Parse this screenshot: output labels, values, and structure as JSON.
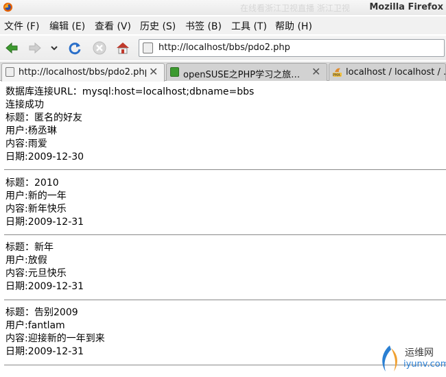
{
  "window": {
    "title": "Mozilla Firefox",
    "ghost_title": "在线看浙江卫视直播  浙江卫视"
  },
  "menu": [
    {
      "label": "文件 (F)"
    },
    {
      "label": "编辑 (E)"
    },
    {
      "label": "查看 (V)"
    },
    {
      "label": "历史 (S)"
    },
    {
      "label": "书签 (B)"
    },
    {
      "label": "工具 (T)"
    },
    {
      "label": "帮助 (H)"
    }
  ],
  "toolbar": {
    "back_icon": "back-arrow-icon",
    "forward_icon": "forward-arrow-icon",
    "history_icon": "chevron-down-icon",
    "reload_icon": "reload-icon",
    "stop_icon": "stop-icon",
    "home_icon": "home-icon"
  },
  "address_bar": {
    "url": "http://localhost/bbs/pdo2.php"
  },
  "tabs": [
    {
      "label": "http://localhost/bbs/pdo2.php",
      "active": true
    },
    {
      "label": "openSUSE之PHP学习之旅…",
      "active": false
    },
    {
      "label": "localhost / localhost / …",
      "active": false
    }
  ],
  "page": {
    "header_lines": [
      "数据库连接URL：mysql:host=localhost;dbname=bbs",
      "连接成功"
    ],
    "posts": [
      {
        "title": "标题：匿名的好友",
        "user": "用户:杨丞琳",
        "content": "内容:雨爱",
        "date": "日期:2009-12-30"
      },
      {
        "title": "标题：2010",
        "user": "用户:新的一年",
        "content": "内容:新年快乐",
        "date": "日期:2009-12-31"
      },
      {
        "title": "标题：新年",
        "user": "用户:放假",
        "content": "内容:元旦快乐",
        "date": "日期:2009-12-31"
      },
      {
        "title": "标题：告别2009",
        "user": "用户:fantlam",
        "content": "内容:迎接新的一年到来",
        "date": "日期:2009-12-31"
      }
    ]
  },
  "watermark": {
    "line1": "运维网",
    "line2": "iyunv.com"
  },
  "colors": {
    "accent_green": "#3c9a2f",
    "reload_blue": "#2a6fc9",
    "home_red": "#c0392b",
    "watermark_blue": "#2a7fd3"
  }
}
